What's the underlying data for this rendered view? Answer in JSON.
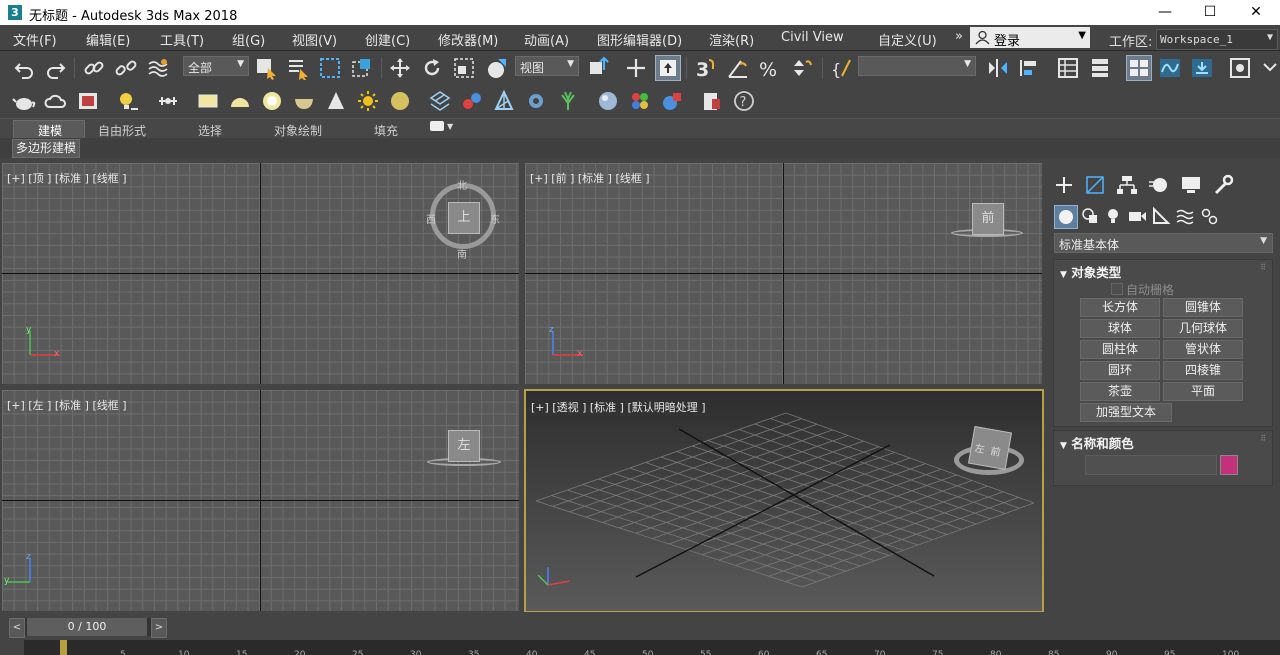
{
  "window": {
    "app_icon": "3",
    "title": "无标题 - Autodesk 3ds Max 2018",
    "minimize": "—",
    "maximize": "☐",
    "close": "✕"
  },
  "menu": [
    "文件(F)",
    "编辑(E)",
    "工具(T)",
    "组(G)",
    "视图(V)",
    "创建(C)",
    "修改器(M)",
    "动画(A)",
    "图形编辑器(D)",
    "渲染(R)",
    "Civil View",
    "自定义(U)"
  ],
  "overflow": "»",
  "login": {
    "label": "登录"
  },
  "workspace": {
    "label": "工作区:",
    "value": "Workspace_1"
  },
  "toolbar": {
    "selection_filter": "全部",
    "ref_coord": "视图",
    "named_selection": ""
  },
  "ribbon": {
    "tabs": [
      "建模",
      "自由形式",
      "选择",
      "对象绘制",
      "填充"
    ],
    "sub_button": "多边形建模"
  },
  "viewports": {
    "top": {
      "label": "[+] [顶 ] [标准 ] [线框 ]",
      "cube": "上",
      "compass": {
        "n": "北",
        "s": "南",
        "e": "东",
        "w": "西"
      },
      "axis_h": "x",
      "axis_v": "y"
    },
    "front": {
      "label": "[+] [前 ] [标准 ] [线框 ]",
      "cube": "前",
      "axis_h": "x",
      "axis_v": "z"
    },
    "left": {
      "label": "[+] [左 ] [标准 ] [线框 ]",
      "cube": "左",
      "axis_h": "y",
      "axis_v": "z"
    },
    "persp": {
      "label": "[+] [透视 ] [标准 ] [默认明暗处理 ]",
      "cube_a": "左",
      "cube_b": "前"
    }
  },
  "cmd": {
    "category": "标准基本体",
    "object_type": {
      "header": "对象类型",
      "autogrid": "自动栅格",
      "buttons": [
        "长方体",
        "圆锥体",
        "球体",
        "几何球体",
        "圆柱体",
        "管状体",
        "圆环",
        "四棱锥",
        "茶壶",
        "平面",
        "加强型文本"
      ]
    },
    "name_color": {
      "header": "名称和颜色",
      "name": "",
      "color": "#c4307a"
    }
  },
  "timeslider": {
    "value": "0 / 100",
    "prev": "<",
    "next": ">"
  },
  "timeline_ticks": [
    "5",
    "10",
    "15",
    "20",
    "25",
    "30",
    "35",
    "40",
    "45",
    "50",
    "55",
    "60",
    "65",
    "70",
    "75",
    "80",
    "85",
    "90",
    "95",
    "100"
  ]
}
